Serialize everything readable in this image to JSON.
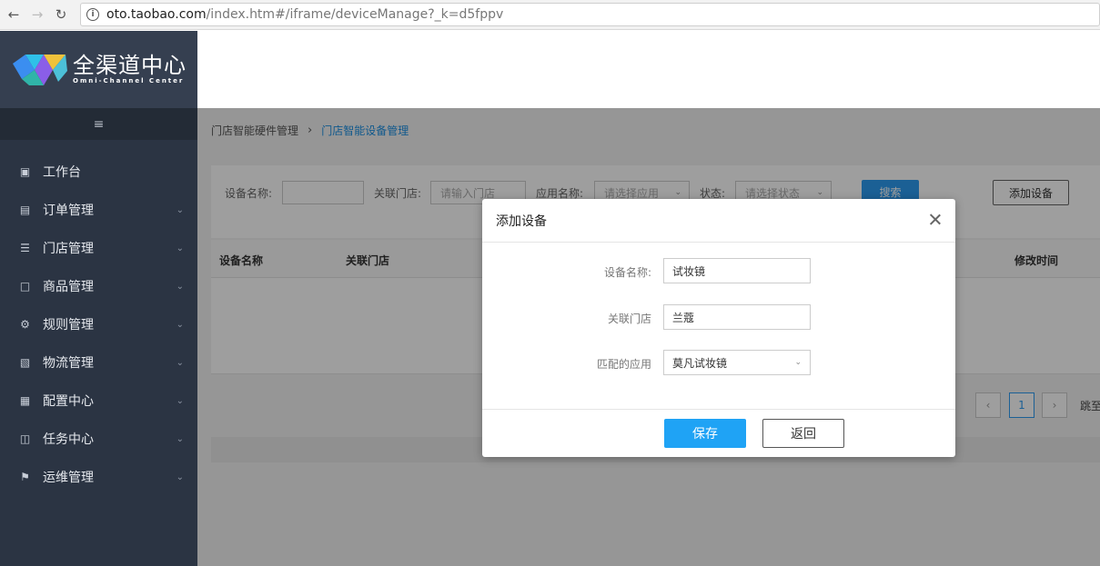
{
  "browser": {
    "url_host": "oto.taobao.com",
    "url_path": "/index.htm#/iframe/deviceManage?_k=d5fppv",
    "back_icon": "arrow-left-icon",
    "forward_icon": "arrow-right-icon",
    "reload_icon": "reload-icon"
  },
  "logo": {
    "cn": "全渠道中心",
    "en": "Omni-Channel Center"
  },
  "sidebar": {
    "collapse_icon": "menu-collapse-icon",
    "items": [
      {
        "label": "工作台",
        "icon": "desktop-icon",
        "expandable": false
      },
      {
        "label": "订单管理",
        "icon": "order-icon",
        "expandable": true
      },
      {
        "label": "门店管理",
        "icon": "list-icon",
        "expandable": true
      },
      {
        "label": "商品管理",
        "icon": "bag-icon",
        "expandable": true
      },
      {
        "label": "规则管理",
        "icon": "rule-icon",
        "expandable": true
      },
      {
        "label": "物流管理",
        "icon": "truck-icon",
        "expandable": true
      },
      {
        "label": "配置中心",
        "icon": "config-icon",
        "expandable": true
      },
      {
        "label": "任务中心",
        "icon": "task-icon",
        "expandable": true
      },
      {
        "label": "运维管理",
        "icon": "ops-icon",
        "expandable": true
      }
    ]
  },
  "breadcrumb": {
    "parent": "门店智能硬件管理",
    "current": "门店智能设备管理"
  },
  "filters": {
    "device_name_label": "设备名称:",
    "device_name_value": "",
    "store_label": "关联门店:",
    "store_placeholder": "请输入门店",
    "app_label": "应用名称:",
    "app_placeholder": "请选择应用",
    "status_label": "状态:",
    "status_placeholder": "请选择状态",
    "search_button": "搜索",
    "add_button": "添加设备"
  },
  "table": {
    "columns": [
      "设备名称",
      "关联门店",
      "修改时间"
    ]
  },
  "pagination": {
    "current_page": "1",
    "jump_label": "跳至"
  },
  "modal": {
    "title": "添加设备",
    "fields": [
      {
        "label": "设备名称:",
        "value": "试妆镜"
      },
      {
        "label": "关联门店",
        "value": "兰蔻"
      },
      {
        "label": "匹配的应用",
        "value": "莫凡试妆镜"
      }
    ],
    "save_button": "保存",
    "back_button": "返回"
  }
}
